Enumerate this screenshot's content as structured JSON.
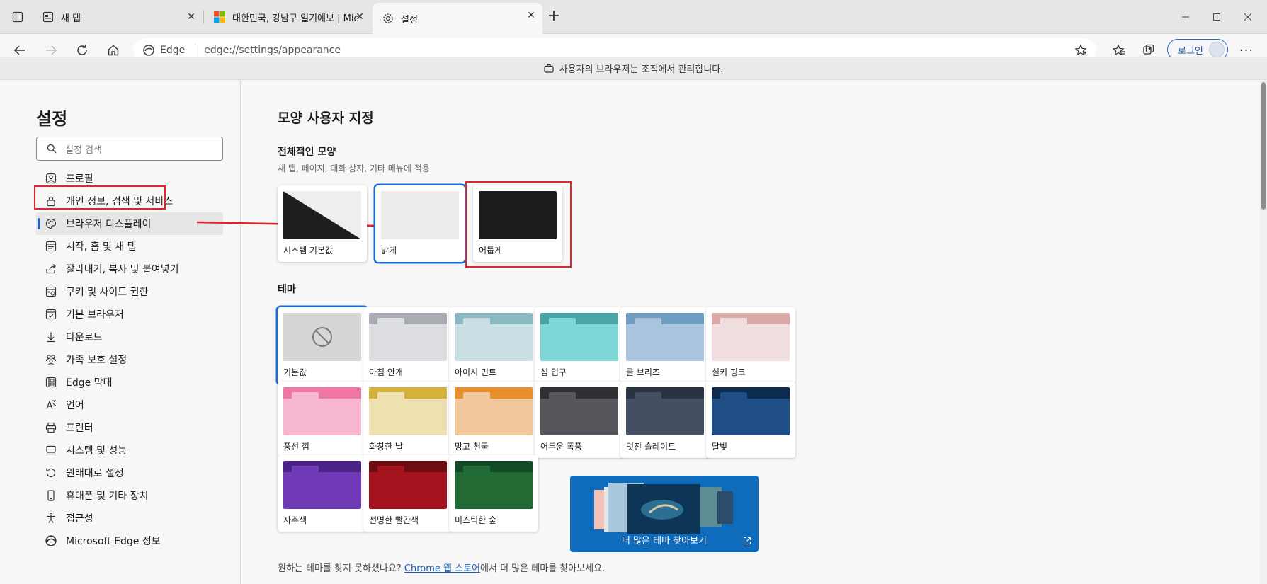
{
  "tabs": [
    {
      "title": "새 탭"
    },
    {
      "title": "대한민국, 강남구 일기예보 | Mic"
    },
    {
      "title": "설정"
    }
  ],
  "address": {
    "identity": "Edge",
    "url": "edge://settings/appearance"
  },
  "toolbar": {
    "login_label": "로그인"
  },
  "banner": {
    "text": "사용자의 브라우저는 조직에서 관리합니다."
  },
  "sidebar": {
    "title": "설정",
    "search_placeholder": "설정 검색",
    "items": [
      {
        "label": "프로필",
        "icon": "profile-icon"
      },
      {
        "label": "개인 정보, 검색 및 서비스",
        "icon": "lock-icon"
      },
      {
        "label": "브라우저 디스플레이",
        "icon": "palette-icon",
        "active": true
      },
      {
        "label": "시작, 홈 및 새 탭",
        "icon": "newtab-icon"
      },
      {
        "label": "잘라내기, 복사 및 붙여넣기",
        "icon": "share-icon"
      },
      {
        "label": "쿠키 및 사이트 권한",
        "icon": "site-permissions-icon"
      },
      {
        "label": "기본 브라우저",
        "icon": "default-browser-icon"
      },
      {
        "label": "다운로드",
        "icon": "download-icon"
      },
      {
        "label": "가족 보호 설정",
        "icon": "family-icon"
      },
      {
        "label": "Edge 막대",
        "icon": "edge-bar-icon"
      },
      {
        "label": "언어",
        "icon": "language-icon"
      },
      {
        "label": "프린터",
        "icon": "printer-icon"
      },
      {
        "label": "시스템 및 성능",
        "icon": "system-icon"
      },
      {
        "label": "원래대로 설정",
        "icon": "reset-icon"
      },
      {
        "label": "휴대폰 및 기타 장치",
        "icon": "phone-icon"
      },
      {
        "label": "접근성",
        "icon": "accessibility-icon"
      },
      {
        "label": "Microsoft Edge 정보",
        "icon": "edge-logo-icon"
      }
    ]
  },
  "main": {
    "title": "모양 사용자 지정",
    "overall": {
      "heading": "전체적인 모양",
      "description": "새 탭, 페이지, 대화 상자, 기타 메뉴에 적용",
      "options": [
        {
          "label": "시스템 기본값"
        },
        {
          "label": "밝게",
          "selected": true
        },
        {
          "label": "어둡게"
        }
      ]
    },
    "theme": {
      "heading": "테마",
      "items": [
        {
          "label": "기본값",
          "selected": true,
          "top": "#cfcfcf",
          "tab": "#cfcfcf",
          "body": "#d6d6d6"
        },
        {
          "label": "아침 안개",
          "top": "#a9adb3",
          "tab": "#dcdde0",
          "body": "#dcdde0"
        },
        {
          "label": "아이시 민트",
          "top": "#8ab9c2",
          "tab": "#c9dfe3",
          "body": "#c9dfe3"
        },
        {
          "label": "섬 입구",
          "top": "#4aa6a6",
          "tab": "#7fd6d6",
          "body": "#7fd6d6"
        },
        {
          "label": "쿨 브리즈",
          "top": "#6f9ec2",
          "tab": "#a9c4dc",
          "body": "#a9c4dc"
        },
        {
          "label": "실키 핑크",
          "top": "#d9aaa8",
          "tab": "#f0dfde",
          "body": "#f0dfde"
        },
        {
          "label": "풍선 껌",
          "top": "#ef76a7",
          "tab": "#f7b6d0",
          "body": "#f7b6d0"
        },
        {
          "label": "화창한 날",
          "top": "#d6b13a",
          "tab": "#efe0b2",
          "body": "#efe0b2"
        },
        {
          "label": "망고 천국",
          "top": "#e88e2c",
          "tab": "#f1c89c",
          "body": "#f1c89c"
        },
        {
          "label": "어두운 폭풍",
          "top": "#2f3033",
          "tab": "#55565b",
          "body": "#55565b"
        },
        {
          "label": "멋진 슬레이트",
          "top": "#2a3342",
          "tab": "#454f63",
          "body": "#454f63"
        },
        {
          "label": "달빛",
          "top": "#0d2a4f",
          "tab": "#1f4d85",
          "body": "#1f4d85"
        },
        {
          "label": "자주색",
          "top": "#4b2386",
          "tab": "#7039b5",
          "body": "#7039b5"
        },
        {
          "label": "선명한 빨간색",
          "top": "#6e0c14",
          "tab": "#a4141e",
          "body": "#a4141e"
        },
        {
          "label": "미스틱한 숲",
          "top": "#124a25",
          "tab": "#236b35",
          "body": "#236b35"
        }
      ],
      "more_label": "더 많은 테마 찾아보기"
    },
    "footer": {
      "prefix": "원하는 테마를 찾지 못하셨나요? ",
      "link": "Chrome 웹 스토어",
      "suffix": "에서 더 많은 테마를 찾아보세요."
    }
  },
  "colors": {
    "accent": "#1b6cd1",
    "annotation_red": "#e0242b"
  }
}
